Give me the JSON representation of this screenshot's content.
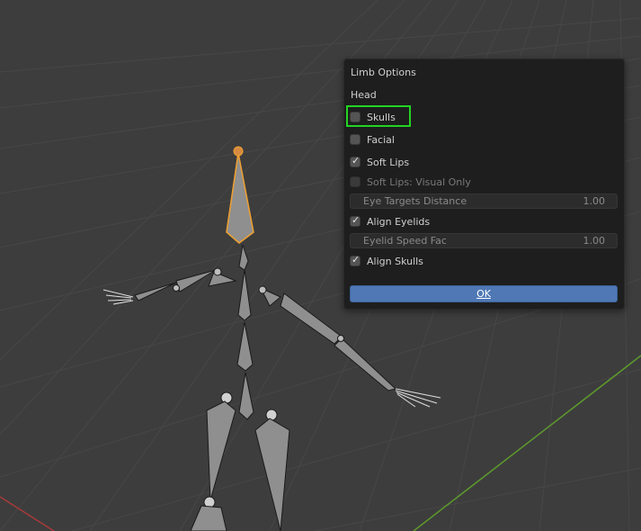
{
  "popup": {
    "title": "Limb Options",
    "section": "Head",
    "options": {
      "skulls": {
        "label": "Skulls",
        "checked": false
      },
      "facial": {
        "label": "Facial",
        "checked": false
      },
      "soft_lips": {
        "label": "Soft Lips",
        "checked": true
      },
      "soft_lips_visual": {
        "label": "Soft Lips: Visual Only",
        "checked": false,
        "disabled": true
      },
      "eye_targets_distance": {
        "label": "Eye Targets Distance",
        "value": "1.00"
      },
      "align_eyelids": {
        "label": "Align Eyelids",
        "checked": true
      },
      "eyelid_speed_fac": {
        "label": "Eyelid Speed Fac",
        "value": "1.00"
      },
      "align_skulls": {
        "label": "Align Skulls",
        "checked": true
      }
    },
    "ok_label": "OK"
  },
  "colors": {
    "accent": "#4f78b5",
    "highlight": "#22d422",
    "selected_bone": "#f0a030"
  }
}
